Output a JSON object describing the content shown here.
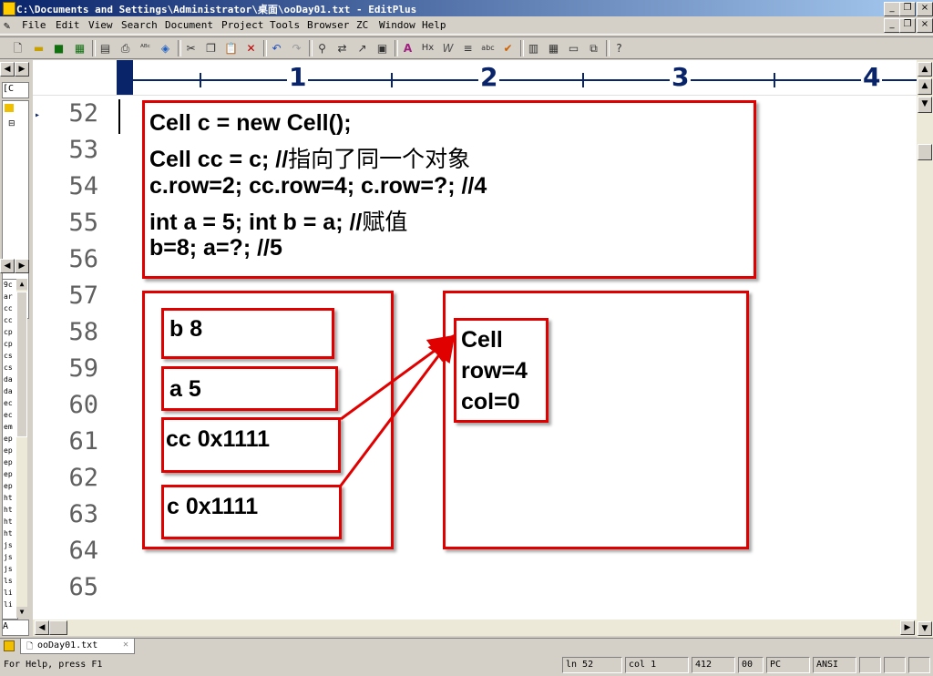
{
  "window": {
    "title": "C:\\Documents and Settings\\Administrator\\桌面\\ooDay01.txt - EditPlus",
    "controls": {
      "minimize": "_",
      "maximize": "❐",
      "close": "×"
    }
  },
  "menu": [
    "File",
    "Edit",
    "View",
    "Search",
    "Document",
    "Project",
    "Tools",
    "Browser",
    "ZC",
    "Window",
    "Help"
  ],
  "toolbar_icons": [
    "new-file-icon",
    "open-folder-icon",
    "save-icon",
    "save-all-icon",
    "print-preview-icon",
    "print-icon",
    "spell-check-icon",
    "browser-icon",
    "cut-icon",
    "copy-icon",
    "paste-icon",
    "delete-icon",
    "undo-icon",
    "redo-icon",
    "find-icon",
    "replace-icon",
    "goto-icon",
    "find-in-files-icon",
    "font-icon",
    "hex-icon",
    "word-wrap-icon",
    "line-numbers-icon",
    "abc-icon",
    "check-icon",
    "panel-icon",
    "output-icon",
    "screen-icon",
    "fullscreen-icon",
    "help-icon"
  ],
  "ruler": {
    "marks": [
      "1",
      "2",
      "3",
      "4"
    ]
  },
  "editor": {
    "line_numbers": [
      "52",
      "53",
      "54",
      "55",
      "56",
      "57",
      "58",
      "59",
      "60",
      "61",
      "62",
      "63",
      "64",
      "65"
    ],
    "code_lines": [
      "Cell  c = new Cell();",
      "Cell  cc = c;   //",
      "c.row=2;  cc.row=4;  c.row=?; //4",
      "int a = 5;  int b = a; //",
      "b=8;  a=?;  //5"
    ],
    "code_comments": {
      "line2": "指向了同一个对象",
      "line4": "赋值"
    },
    "stack_vars": [
      "b  8",
      "a  5",
      "cc 0x1111",
      "c 0x1111"
    ],
    "heap_object": [
      "Cell",
      "row=4",
      "col=0"
    ]
  },
  "left_panel": {
    "combo": "[C",
    "files": [
      "9c",
      "ar",
      "cc",
      "cc",
      "cp",
      "cp",
      "cs",
      "cs",
      "da",
      "da",
      "ec",
      "ec",
      "em",
      "ep",
      "ep",
      "ep",
      "ep",
      "ep",
      "ht",
      "ht",
      "ht",
      "ht",
      "js",
      "js",
      "js",
      "ls",
      "li",
      "li"
    ],
    "combo2": "A"
  },
  "tabs": [
    {
      "label": "ooDay01.txt"
    }
  ],
  "status": {
    "help": "For Help, press F1",
    "ln": "ln 52",
    "col": "col 1",
    "count": "412",
    "ov": "00",
    "pc": "PC",
    "enc": "ANSI"
  },
  "colors": {
    "annotation": "#e00000",
    "titlebar": "#0a246a",
    "ruler": "#0a246a"
  }
}
